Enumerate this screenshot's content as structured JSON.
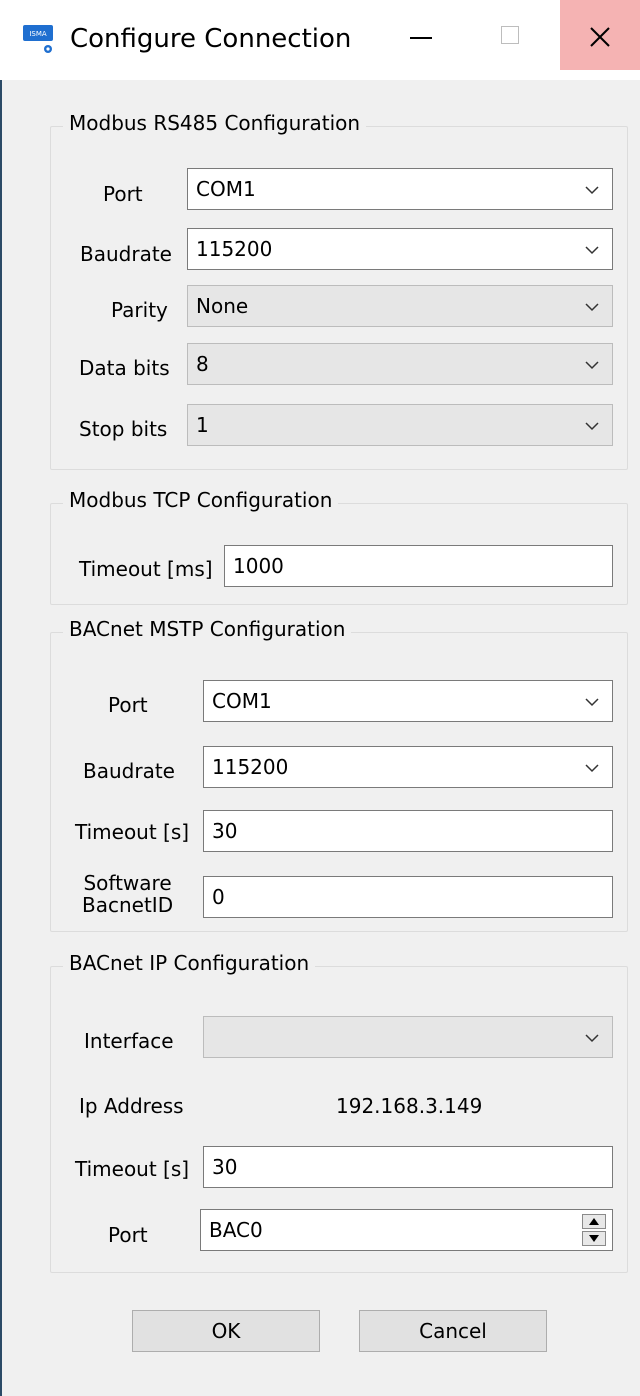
{
  "window": {
    "title": "Configure Connection",
    "icon_text": "ISMA",
    "controls": [
      "minimize-icon",
      "maximize-icon",
      "close-icon"
    ]
  },
  "modbus_rs485": {
    "title": "Modbus RS485 Configuration",
    "port_label": "Port",
    "port_value": "COM1",
    "baudrate_label": "Baudrate",
    "baudrate_value": "115200",
    "parity_label": "Parity",
    "parity_value": "None",
    "databits_label": "Data bits",
    "databits_value": "8",
    "stopbits_label": "Stop bits",
    "stopbits_value": "1"
  },
  "modbus_tcp": {
    "title": "Modbus TCP Configuration",
    "timeout_label": "Timeout [ms]",
    "timeout_value": "1000"
  },
  "bacnet_mstp": {
    "title": "BACnet MSTP Configuration",
    "port_label": "Port",
    "port_value": "COM1",
    "baudrate_label": "Baudrate",
    "baudrate_value": "115200",
    "timeout_label": "Timeout [s]",
    "timeout_value": "30",
    "software_id_label_line1": "Software",
    "software_id_label_line2": "BacnetID",
    "software_id_value": "0"
  },
  "bacnet_ip": {
    "title": "BACnet IP Configuration",
    "interface_label": "Interface",
    "interface_value": "",
    "ip_label": "Ip Address",
    "ip_value": "192.168.3.149",
    "timeout_label": "Timeout [s]",
    "timeout_value": "30",
    "port_label": "Port",
    "port_value": "BAC0"
  },
  "buttons": {
    "ok": "OK",
    "cancel": "Cancel"
  },
  "colors": {
    "background": "#f0f0f0",
    "close_hover": "#f5b3b3",
    "icon_blue": "#1f6fd0"
  }
}
